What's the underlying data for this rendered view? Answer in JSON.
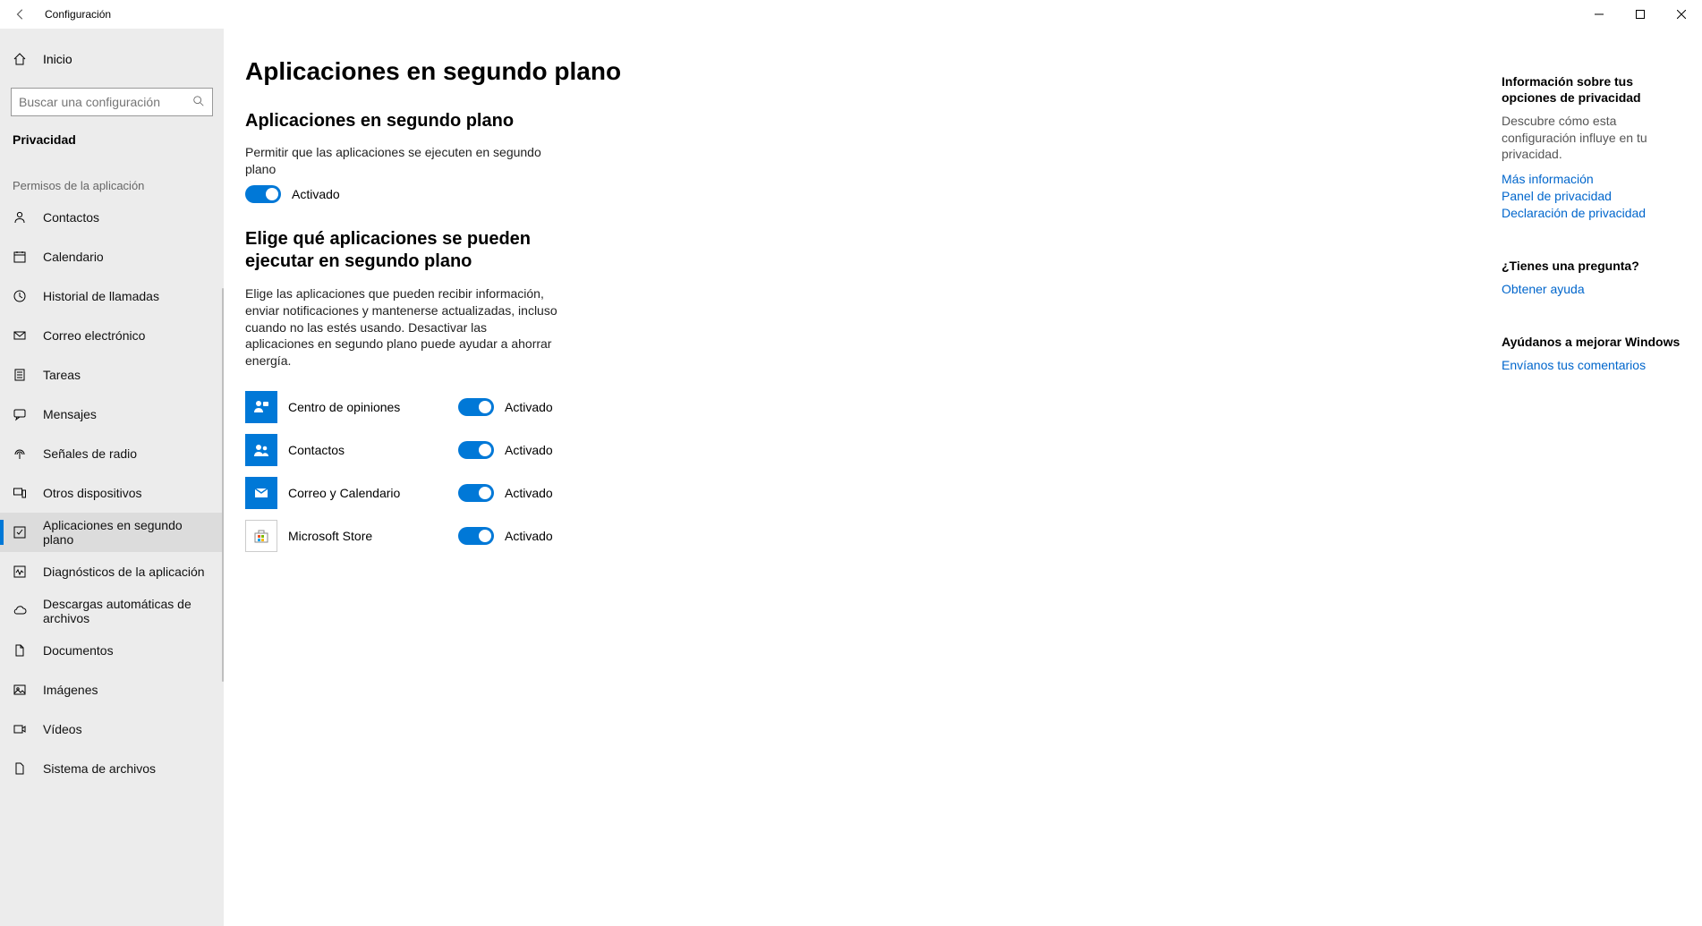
{
  "titlebar": {
    "title": "Configuración"
  },
  "sidebar": {
    "home": "Inicio",
    "search_placeholder": "Buscar una configuración",
    "category": "Privacidad",
    "subheader": "Permisos de la aplicación",
    "items": [
      {
        "label": "Contactos"
      },
      {
        "label": "Calendario"
      },
      {
        "label": "Historial de llamadas"
      },
      {
        "label": "Correo electrónico"
      },
      {
        "label": "Tareas"
      },
      {
        "label": "Mensajes"
      },
      {
        "label": "Señales de radio"
      },
      {
        "label": "Otros dispositivos"
      },
      {
        "label": "Aplicaciones en segundo plano"
      },
      {
        "label": "Diagnósticos de la aplicación"
      },
      {
        "label": "Descargas automáticas de archivos"
      },
      {
        "label": "Documentos"
      },
      {
        "label": "Imágenes"
      },
      {
        "label": "Vídeos"
      },
      {
        "label": "Sistema de archivos"
      }
    ]
  },
  "page": {
    "title": "Aplicaciones en segundo plano",
    "section1_title": "Aplicaciones en segundo plano",
    "section1_desc": "Permitir que las aplicaciones se ejecuten en segundo plano",
    "on_label": "Activado",
    "section2_title": "Elige qué aplicaciones se pueden ejecutar en segundo plano",
    "section2_desc": "Elige las aplicaciones que pueden recibir información, enviar notificaciones y mantenerse actualizadas, incluso cuando no las estés usando. Desactivar las aplicaciones en segundo plano puede ayudar a ahorrar energía.",
    "apps": [
      {
        "name": "Centro de opiniones",
        "state": "Activado"
      },
      {
        "name": "Contactos",
        "state": "Activado"
      },
      {
        "name": "Correo y Calendario",
        "state": "Activado"
      },
      {
        "name": "Microsoft Store",
        "state": "Activado"
      }
    ]
  },
  "right": {
    "g1_title": "Información sobre tus opciones de privacidad",
    "g1_desc": "Descubre cómo esta configuración influye en tu privacidad.",
    "links1": [
      "Más información",
      "Panel de privacidad",
      "Declaración de privacidad"
    ],
    "g2_title": "¿Tienes una pregunta?",
    "g2_link": "Obtener ayuda",
    "g3_title": "Ayúdanos a mejorar Windows",
    "g3_link": "Envíanos tus comentarios"
  }
}
